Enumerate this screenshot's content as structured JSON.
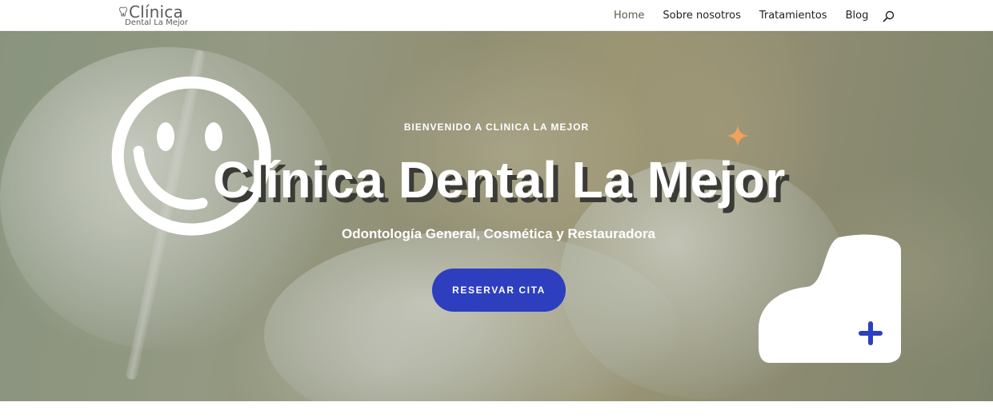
{
  "header": {
    "logo": {
      "title": "Clínica",
      "subtitle": "Dental La Mejor",
      "icon": "tooth-icon"
    },
    "nav": [
      {
        "label": "Home",
        "active": true
      },
      {
        "label": "Sobre nosotros",
        "active": false
      },
      {
        "label": "Tratamientos",
        "active": false
      },
      {
        "label": "Blog",
        "active": false
      }
    ],
    "search_icon": "search-icon"
  },
  "hero": {
    "kicker": "BIENVENIDO A CLINICA LA MEJOR",
    "title": "Clínica Dental La Mejor",
    "subtitle": "Odontología General, Cosmética y Restauradora",
    "cta_label": "RESERVAR CITA",
    "decorations": [
      "smiley-icon",
      "sparkle-icon",
      "blob-shape",
      "plus-icon"
    ]
  },
  "colors": {
    "accent_blue": "#2d3fbf",
    "sparkle_orange": "#f2a25a",
    "nav_text": "#1f1f1f",
    "nav_active": "#5e5a4a",
    "white": "#ffffff"
  }
}
